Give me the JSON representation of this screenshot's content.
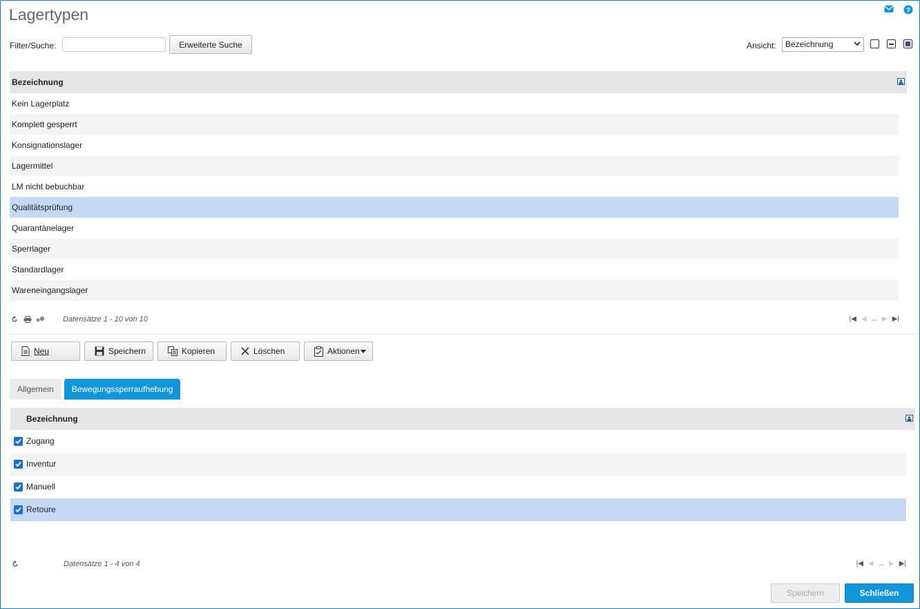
{
  "page": {
    "title": "Lagertypen"
  },
  "filter": {
    "label": "Filter/Suche:",
    "value": "",
    "extended_search": "Erweiterte Suche",
    "view_label": "Ansicht:",
    "view_selected": "Bezeichnung"
  },
  "grid1": {
    "header": "Bezeichnung",
    "rows": [
      "Kein Lagerplatz",
      "Komplett gesperrt",
      "Konsignationslager",
      "Lagermittel",
      "LM nicht bebuchbar",
      "Qualitätsprüfung",
      "Quarantänelager",
      "Sperrlager",
      "Standardlager",
      "Wareneingangslager"
    ],
    "selected_index": 5,
    "records": "Datensätze 1 - 10 von 10",
    "ellipsis": "..."
  },
  "actions": {
    "new": "Neu",
    "save": "Speichern",
    "copy": "Kopieren",
    "delete": "Löschen",
    "actions": "Aktionen"
  },
  "tabs": [
    "Allgemein",
    "Bewegungssperraufhebung"
  ],
  "grid2": {
    "header": "Bezeichnung",
    "rows": [
      {
        "label": "Zugang",
        "checked": true
      },
      {
        "label": "Inventur",
        "checked": true
      },
      {
        "label": "Manuell",
        "checked": true
      },
      {
        "label": "Retoure",
        "checked": true
      }
    ],
    "selected_index": 3,
    "records": "Datensätze 1 - 4 von 4",
    "ellipsis": "..."
  },
  "footer": {
    "save": "Speichern",
    "close": "Schließen"
  },
  "colors": {
    "accent": "#1296db",
    "selection": "#c5d9f7",
    "checkbox": "#1b6fd1"
  }
}
